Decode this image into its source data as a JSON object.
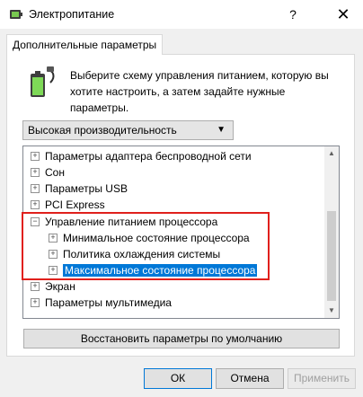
{
  "window": {
    "title": "Электропитание",
    "help_glyph": "?",
    "close_glyph": "✕"
  },
  "tab": {
    "label": "Дополнительные параметры"
  },
  "description": "Выберите схему управления питанием, которую вы хотите настроить, а затем задайте нужные параметры.",
  "plan_select": {
    "value": "Высокая производительность"
  },
  "tree": {
    "items": [
      {
        "label": "Параметры адаптера беспроводной сети",
        "expander": "+"
      },
      {
        "label": "Сон",
        "expander": "+"
      },
      {
        "label": "Параметры USB",
        "expander": "+"
      },
      {
        "label": "PCI Express",
        "expander": "+"
      },
      {
        "label": "Управление питанием процессора",
        "expander": "−"
      },
      {
        "label": "Минимальное состояние процессора",
        "expander": "+"
      },
      {
        "label": "Политика охлаждения системы",
        "expander": "+"
      },
      {
        "label": "Максимальное состояние процессора",
        "expander": "+"
      },
      {
        "label": "Экран",
        "expander": "+"
      },
      {
        "label": "Параметры мультимедиа",
        "expander": "+"
      }
    ]
  },
  "buttons": {
    "restore": "Восстановить параметры по умолчанию",
    "ok": "ОК",
    "cancel": "Отмена",
    "apply": "Применить"
  },
  "colors": {
    "selection": "#0078d7",
    "highlight_box": "#e0201c"
  }
}
